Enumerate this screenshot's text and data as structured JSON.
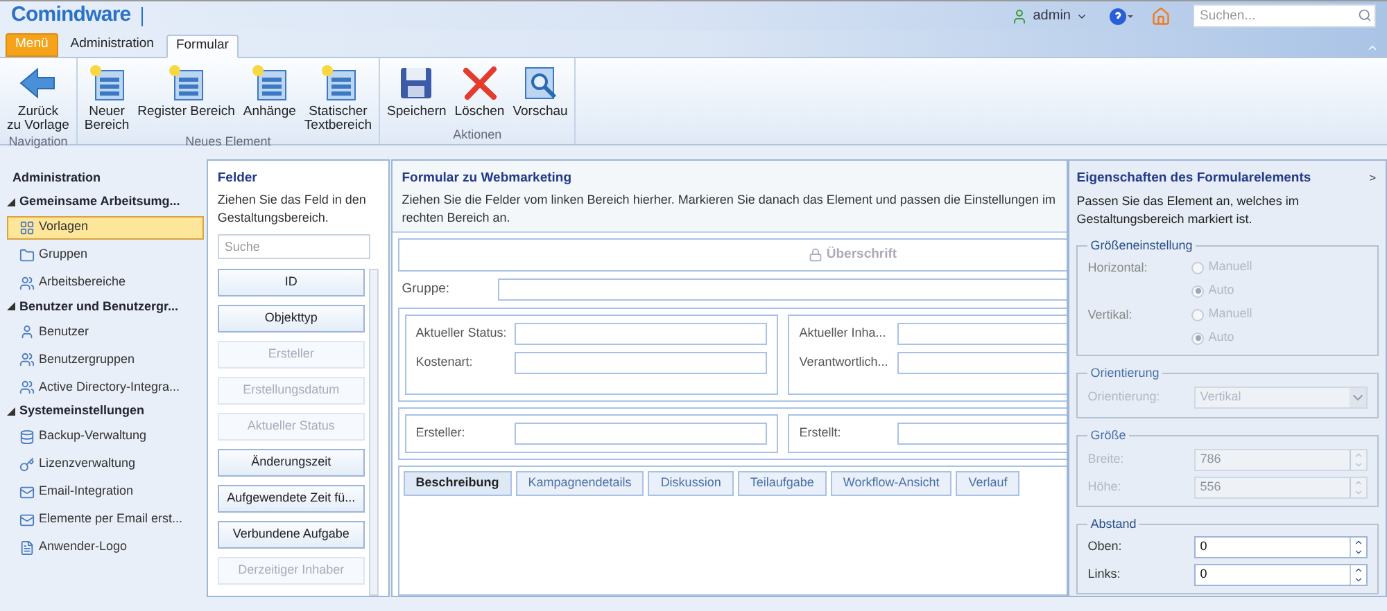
{
  "header": {
    "logo": "Comindware",
    "user": "admin",
    "search_placeholder": "Suchen..."
  },
  "ribbon_tabs": [
    {
      "label": "Menü",
      "kind": "menu",
      "selected": false
    },
    {
      "label": "Administration",
      "kind": "tab",
      "selected": false
    },
    {
      "label": "Formular",
      "kind": "tab",
      "selected": true
    }
  ],
  "ribbon_groups": [
    {
      "label": "Navigation",
      "buttons": [
        "Zurück\nzu Vorlage"
      ]
    },
    {
      "label": "Neues Element",
      "buttons": [
        "Neuer\nBereich",
        "Register Bereich",
        "Anhänge",
        "Statischer\nTextbereich"
      ]
    },
    {
      "label": "Aktionen",
      "buttons": [
        "Speichern",
        "Löschen",
        "Vorschau"
      ]
    }
  ],
  "sidebar": {
    "title": "Administration",
    "groups": [
      {
        "label": "Gemeinsame Arbeitsumg...",
        "expanded": true,
        "children": [
          {
            "label": "Vorlagen",
            "selected": true
          },
          {
            "label": "Gruppen",
            "selected": false
          },
          {
            "label": "Arbeitsbereiche",
            "selected": false
          }
        ]
      },
      {
        "label": "Benutzer und Benutzergr...",
        "expanded": true,
        "children": [
          {
            "label": "Benutzer",
            "selected": false
          },
          {
            "label": "Benutzergruppen",
            "selected": false
          },
          {
            "label": "Active Directory-Integra...",
            "selected": false
          }
        ]
      },
      {
        "label": "Systemeinstellungen",
        "expanded": true,
        "children": [
          {
            "label": "Backup-Verwaltung",
            "selected": false
          },
          {
            "label": "Lizenzverwaltung",
            "selected": false
          },
          {
            "label": "Email-Integration",
            "selected": false
          },
          {
            "label": "Elemente per Email erst...",
            "selected": false
          },
          {
            "label": "Anwender-Logo",
            "selected": false
          }
        ]
      }
    ]
  },
  "fields_panel": {
    "title": "Felder",
    "description": "Ziehen Sie das Feld in den Gestaltungsbereich.",
    "search_placeholder": "Suche",
    "fields": [
      {
        "label": "ID",
        "disabled": false
      },
      {
        "label": "Objekttyp",
        "disabled": false
      },
      {
        "label": "Ersteller",
        "disabled": true
      },
      {
        "label": "Erstellungsdatum",
        "disabled": true
      },
      {
        "label": "Aktueller Status",
        "disabled": true
      },
      {
        "label": "Änderungszeit",
        "disabled": false
      },
      {
        "label": "Aufgewendete Zeit fü...",
        "disabled": false
      },
      {
        "label": "Verbundene Aufgabe",
        "disabled": false
      },
      {
        "label": "Derzeitiger Inhaber",
        "disabled": true
      }
    ]
  },
  "form": {
    "title": "Formular zu Webmarketing",
    "description": "Ziehen Sie die Felder vom linken Bereich hierher. Markieren Sie danach das Element und passen die Einstellungen im rechten Bereich an.",
    "heading": "Überschrift",
    "group_label": "Gruppe:",
    "sections": [
      {
        "columns": [
          [
            "Aktueller Status:",
            "Kostenart:"
          ],
          [
            "Aktueller Inha...",
            "Verantwortlich..."
          ]
        ]
      },
      {
        "columns": [
          [
            "Ersteller:"
          ],
          [
            "Erstellt:"
          ]
        ]
      }
    ],
    "tabs": [
      {
        "label": "Beschreibung",
        "selected": true
      },
      {
        "label": "Kampagnendetails",
        "selected": false
      },
      {
        "label": "Diskussion",
        "selected": false
      },
      {
        "label": "Teilaufgabe",
        "selected": false
      },
      {
        "label": "Workflow-Ansicht",
        "selected": false
      },
      {
        "label": "Verlauf",
        "selected": false
      }
    ]
  },
  "properties": {
    "title": "Eigenschaften des Formularelements",
    "collapse": ">",
    "description": "Passen Sie das Element an, welches im Gestaltungsbereich markiert ist.",
    "groups": [
      {
        "legend": "Größeneinstellung",
        "kind": "radios",
        "disabled": true,
        "rows": [
          {
            "label": "Horizontal:",
            "options": [
              {
                "label": "Manuell",
                "selected": false
              },
              {
                "label": "Auto",
                "selected": true
              }
            ]
          },
          {
            "label": "Vertikal:",
            "options": [
              {
                "label": "Manuell",
                "selected": false
              },
              {
                "label": "Auto",
                "selected": true
              }
            ]
          }
        ]
      },
      {
        "legend": "Orientierung",
        "kind": "select",
        "disabled": true,
        "rows": [
          {
            "label": "Orientierung:",
            "value": "Vertikal"
          }
        ]
      },
      {
        "legend": "Größe",
        "kind": "spinners",
        "disabled": true,
        "rows": [
          {
            "label": "Breite:",
            "value": "786"
          },
          {
            "label": "Höhe:",
            "value": "556"
          }
        ]
      },
      {
        "legend": "Abstand",
        "kind": "spinners",
        "disabled": false,
        "rows": [
          {
            "label": "Oben:",
            "value": "0"
          },
          {
            "label": "Links:",
            "value": "0"
          }
        ]
      }
    ]
  }
}
